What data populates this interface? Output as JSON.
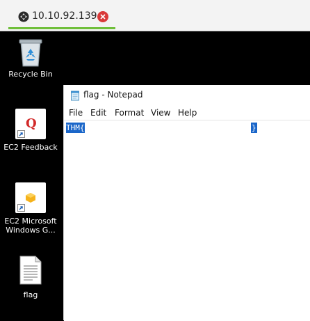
{
  "tab": {
    "title": "10.10.92.139",
    "active_color": "#6fbf3a",
    "close_color": "#d93a3a"
  },
  "desktop": {
    "icons": [
      {
        "label": "Recycle Bin",
        "icon": "recycle-bin-icon"
      },
      {
        "label": "EC2 Feedback",
        "icon": "ec2-feedback-icon"
      },
      {
        "label_lines": [
          "EC2 Microsoft",
          "Windows G..."
        ],
        "icon": "ec2-windows-guide-icon"
      },
      {
        "label": "flag",
        "icon": "text-file-icon"
      }
    ]
  },
  "notepad": {
    "title": "flag - Notepad",
    "menu": [
      "File",
      "Edit",
      "Format",
      "View",
      "Help"
    ],
    "content_start": "THM{",
    "content_end": "}",
    "selection_color": "#1a66c9"
  }
}
